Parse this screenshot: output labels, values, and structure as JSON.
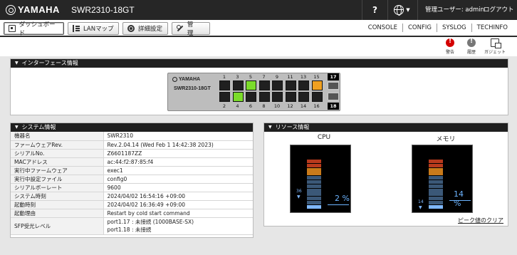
{
  "header": {
    "brand": "YAMAHA",
    "model": "SWR2310-18GT",
    "help": "?",
    "user_label": "管理ユーザー: admin",
    "logout": "ログアウト"
  },
  "tabs": [
    {
      "label": "ダッシュボード",
      "icon": "dashboard-icon",
      "active": true
    },
    {
      "label": "LANマップ",
      "icon": "lan-map-icon"
    },
    {
      "label": "詳細設定",
      "icon": "gear-icon"
    },
    {
      "label": "管　理",
      "icon": "wrench-icon"
    }
  ],
  "right_links": [
    "CONSOLE",
    "CONFIG",
    "SYSLOG",
    "TECHINFO"
  ],
  "tools": [
    {
      "label": "警告",
      "icon": "alarm-icon"
    },
    {
      "label": "履歴",
      "icon": "history-icon"
    },
    {
      "label": "ガジェット",
      "icon": "gadget-icon"
    }
  ],
  "interface_panel": {
    "title": "インターフェース情報",
    "switch_brand": "YAMAHA",
    "switch_model": "SWR2310-18GT",
    "top_ports": [
      "1",
      "3",
      "5",
      "7",
      "9",
      "11",
      "13",
      "15"
    ],
    "bottom_ports": [
      "2",
      "4",
      "6",
      "8",
      "10",
      "12",
      "14",
      "16"
    ],
    "sfp_ports": [
      "17",
      "18"
    ],
    "port_status": {
      "1": "off",
      "2": "off",
      "3": "off",
      "4": "link",
      "5": "link",
      "6": "off",
      "7": "off",
      "8": "off",
      "9": "off",
      "10": "off",
      "11": "off",
      "12": "off",
      "13": "off",
      "14": "off",
      "15": "warning",
      "16": "off"
    },
    "status_colors": {
      "off": "#202020",
      "link": "#7bdc2a",
      "warning": "#f0a020"
    }
  },
  "system_panel": {
    "title": "システム情報",
    "rows": [
      {
        "key": "機器名",
        "value": "SWR2310"
      },
      {
        "key": "ファームウェアRev.",
        "value": "Rev.2.04.14 (Wed Feb 1 14:42:38 2023)"
      },
      {
        "key": "シリアルNo.",
        "value": "Z6601187ZZ"
      },
      {
        "key": "MACアドレス",
        "value": "ac:44:f2:87:85:f4"
      },
      {
        "key": "実行中ファームウェア",
        "value": "exec1"
      },
      {
        "key": "実行中設定ファイル",
        "value": "config0"
      },
      {
        "key": "シリアルボーレート",
        "value": "9600"
      },
      {
        "key": "システム時刻",
        "value": "2024/04/02 16:54:16 +09:00"
      },
      {
        "key": "起動時刻",
        "value": "2024/04/02 16:36:49 +09:00"
      },
      {
        "key": "起動理由",
        "value": "Restart by cold start command"
      }
    ],
    "sfp_row": {
      "key": "SFP受光レベル",
      "values": [
        "port1.17 : 未接続 (1000BASE-SX)",
        "port1.18 : 未接続"
      ]
    }
  },
  "resource_panel": {
    "title": "リソース情報",
    "cpu": {
      "label": "CPU",
      "value": "2",
      "unit": "%",
      "peak": "36",
      "current_fraction": 0.02,
      "peak_fraction": 0.36
    },
    "memory": {
      "label": "メモリ",
      "value": "14",
      "unit": "%",
      "peak": "14",
      "current_fraction": 0.14,
      "peak_fraction": 0.14
    },
    "peak_clear": "ピーク値のクリア"
  }
}
